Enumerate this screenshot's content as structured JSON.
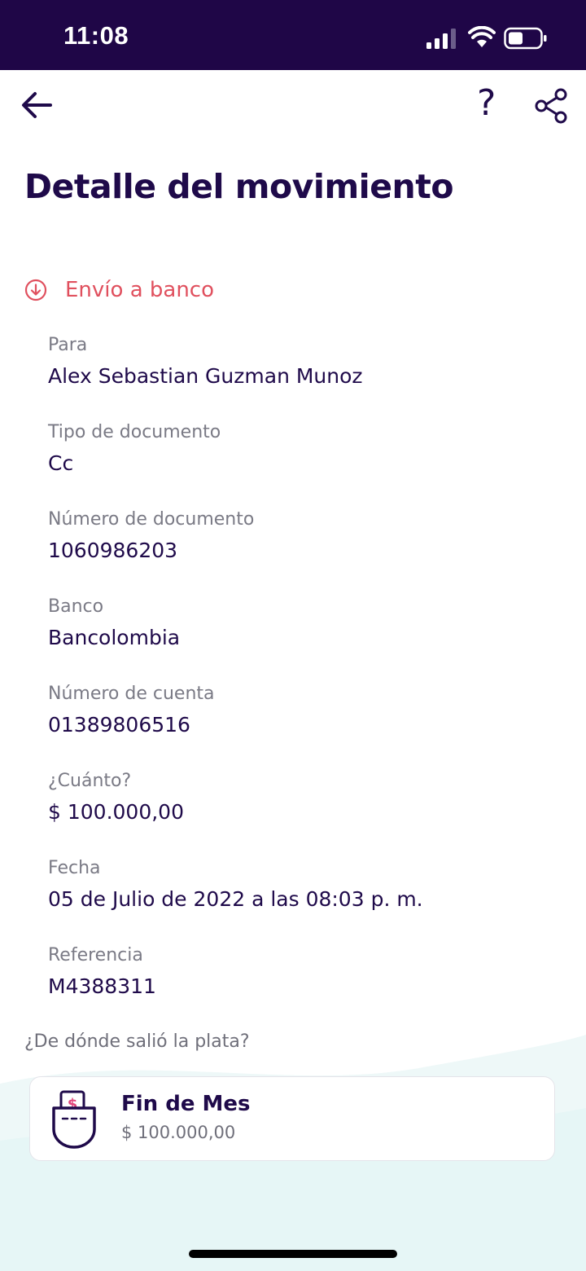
{
  "status_bar": {
    "time": "11:08"
  },
  "toolbar": {
    "help_label": "?"
  },
  "title": "Detalle del movimiento",
  "movement": {
    "type_label": "Envío a banco",
    "type_icon": "arrow-down-circle-icon"
  },
  "details": [
    {
      "label": "Para",
      "value": "Alex Sebastian Guzman Munoz"
    },
    {
      "label": "Tipo de documento",
      "value": "Cc"
    },
    {
      "label": "Número de documento",
      "value": "1060986203"
    },
    {
      "label": "Banco",
      "value": "Bancolombia"
    },
    {
      "label": "Número de cuenta",
      "value": "01389806516"
    },
    {
      "label": "¿Cuánto?",
      "value": "$ 100.000,00"
    },
    {
      "label": "Fecha",
      "value": "05 de Julio de 2022 a las 08:03 p. m."
    },
    {
      "label": "Referencia",
      "value": "M4388311"
    }
  ],
  "source": {
    "question": "¿De dónde salió la plata?",
    "pocket_name": "Fin de Mes",
    "pocket_amount": "$ 100.000,00",
    "pocket_icon": "pocket-money-icon"
  },
  "colors": {
    "brand_dark": "#1f0647",
    "text_primary": "#1f0a4a",
    "accent_red": "#e0505e",
    "accent_pink": "#e0457b",
    "text_secondary": "#7a7a85"
  }
}
